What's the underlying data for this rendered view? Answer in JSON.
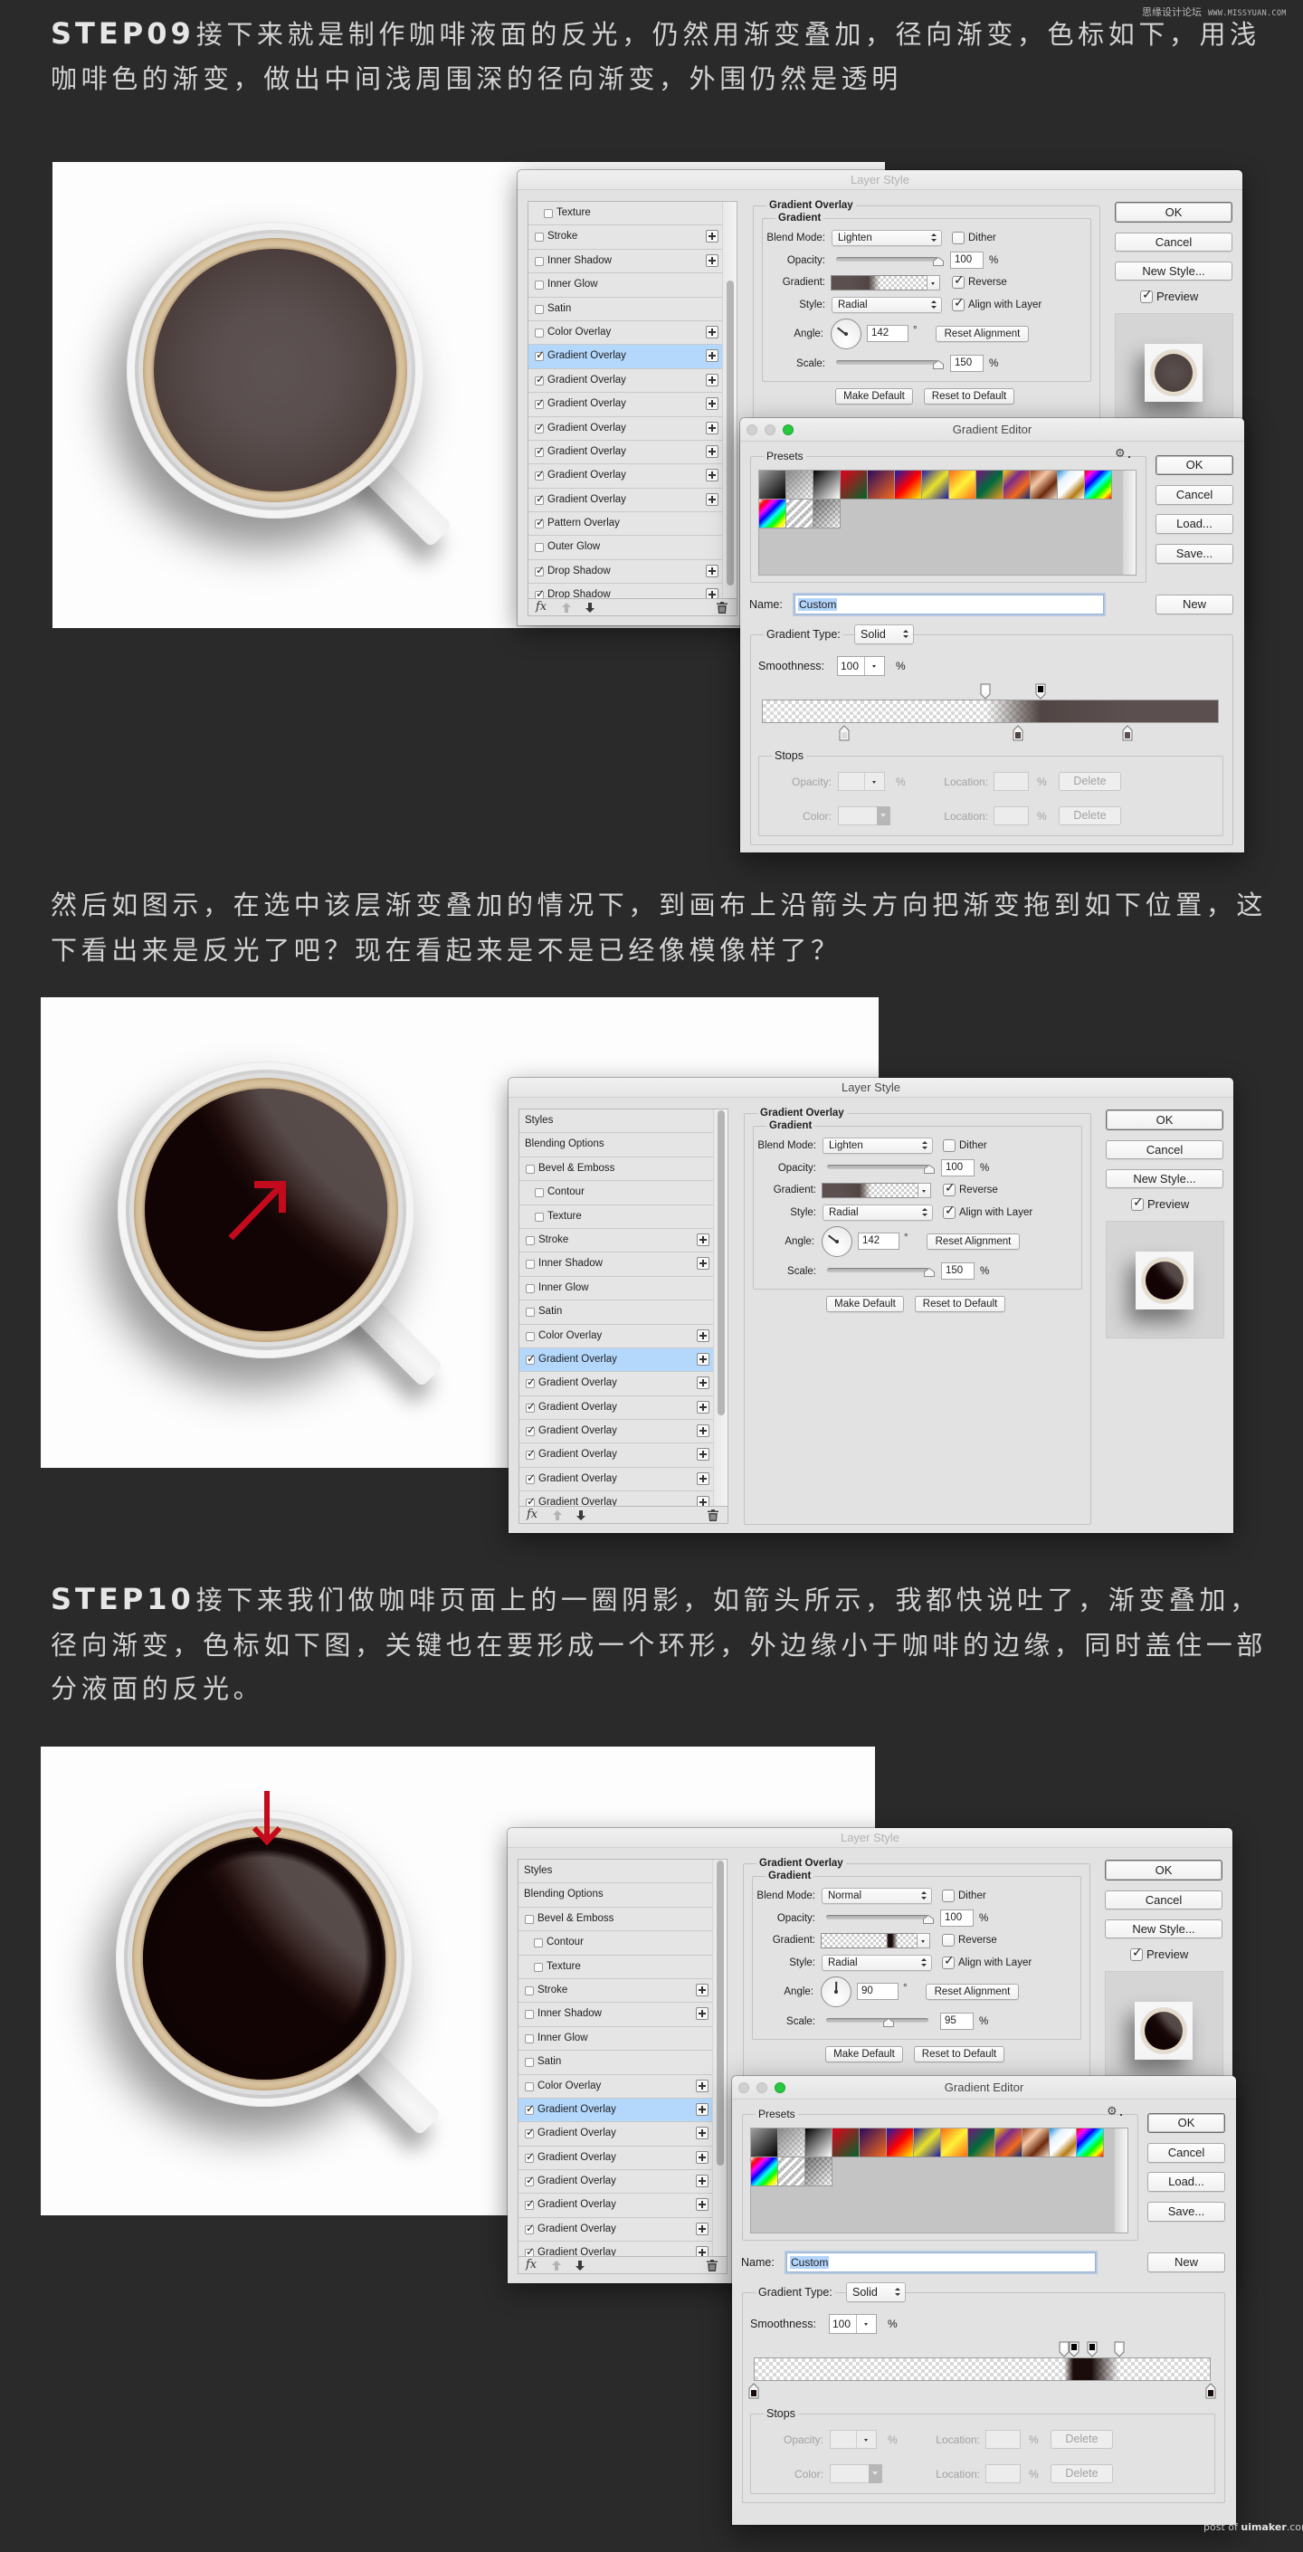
{
  "theme": {
    "page_bg": "#2a2a2a",
    "text": "#d3d3d3",
    "arrow": "#c30b1d",
    "canvas_bg": "#fdfdfd",
    "list_selection": "#b4d8fc",
    "window_zoom_button": "#28c840"
  },
  "watermark_top": {
    "site_name": "思缘设计论坛",
    "site_url": "WWW.MISSYUAN.COM"
  },
  "watermark_bottom": {
    "prefix": "post of ",
    "brand": "uimaker",
    "suffix": ".com"
  },
  "step09": {
    "label": "STEP09",
    "lines": [
      "接下来就是制作咖啡液面的反光，仍然用渐变叠加，径向渐变，色标如下，用浅",
      "咖啡色的渐变，做出中间浅周围深的径向渐变，外围仍然是透明"
    ]
  },
  "note": {
    "lines": [
      "然后如图示，在选中该层渐变叠加的情况下，到画布上沿箭头方向把渐变拖到如下位置，这",
      "下看出来是反光了吧？现在看起来是不是已经像模像样了？"
    ]
  },
  "step10": {
    "label": "STEP10",
    "lines": [
      "接下来我们做咖啡页面上的一圈阴影，如箭头所示，我都快说吐了，渐变叠加，",
      "径向渐变，色标如下图，关键也在要形成一个环形，外边缘小于咖啡的边缘，同时盖住一部",
      "分液面的反光。"
    ]
  },
  "canvases": [
    {
      "liquid": {
        "reflection": false,
        "shadow_ring": false
      },
      "arrow": null
    },
    {
      "liquid": {
        "reflection": true,
        "shadow_ring": false
      },
      "arrow": "up-right"
    },
    {
      "liquid": {
        "reflection": true,
        "shadow_ring": true
      },
      "arrow": "down"
    }
  ],
  "ranges": {
    "opacity": [
      0,
      100
    ],
    "scale": [
      10,
      150
    ]
  },
  "ls_labels": {
    "title": "Layer Style",
    "section_title": "Gradient Overlay",
    "subsection_title": "Gradient",
    "blend_mode": "Blend Mode:",
    "dither": "Dither",
    "opacity": "Opacity:",
    "percent": "%",
    "gradient": "Gradient:",
    "reverse": "Reverse",
    "style": "Style:",
    "align_with_layer": "Align with Layer",
    "angle": "Angle:",
    "degree": "°",
    "reset_alignment": "Reset Alignment",
    "scale": "Scale:",
    "make_default": "Make Default",
    "reset_to_default": "Reset to Default",
    "ok": "OK",
    "cancel": "Cancel",
    "new_style": "New Style...",
    "preview": "Preview",
    "fx": "fx"
  },
  "layer_style_dialogs": [
    {
      "title_active": false,
      "list_scroll": {
        "position": 0.85,
        "visible_fraction": 0.77
      },
      "list_items": [
        {
          "label": "Texture",
          "checkbox": true,
          "indent": true
        },
        {
          "label": "Stroke",
          "checkbox": true,
          "add_button": true
        },
        {
          "label": "Inner Shadow",
          "checkbox": true,
          "add_button": true
        },
        {
          "label": "Inner Glow",
          "checkbox": true
        },
        {
          "label": "Satin",
          "checkbox": true
        },
        {
          "label": "Color Overlay",
          "checkbox": true,
          "add_button": true
        },
        {
          "label": "Gradient Overlay",
          "checkbox": true,
          "checked": true,
          "add_button": true,
          "selected": true
        },
        {
          "label": "Gradient Overlay",
          "checkbox": true,
          "checked": true,
          "add_button": true
        },
        {
          "label": "Gradient Overlay",
          "checkbox": true,
          "checked": true,
          "add_button": true
        },
        {
          "label": "Gradient Overlay",
          "checkbox": true,
          "checked": true,
          "add_button": true
        },
        {
          "label": "Gradient Overlay",
          "checkbox": true,
          "checked": true,
          "add_button": true
        },
        {
          "label": "Gradient Overlay",
          "checkbox": true,
          "checked": true,
          "add_button": true
        },
        {
          "label": "Gradient Overlay",
          "checkbox": true,
          "checked": true,
          "add_button": true
        },
        {
          "label": "Pattern Overlay",
          "checkbox": true,
          "checked": true
        },
        {
          "label": "Outer Glow",
          "checkbox": true
        },
        {
          "label": "Drop Shadow",
          "checkbox": true,
          "checked": true,
          "add_button": true
        },
        {
          "label": "Drop Shadow",
          "checkbox": true,
          "checked": true,
          "add_button": true
        }
      ],
      "blend_mode": "Lighten",
      "dither": false,
      "opacity": 100,
      "gradient": 0,
      "reverse": true,
      "style": "Radial",
      "align_with_layer": true,
      "angle": 142,
      "scale": 150,
      "preview": true,
      "preview_thumb": {
        "reflection": false
      }
    },
    {
      "title_active": true,
      "list_scroll": {
        "position": 0,
        "visible_fraction": 0.77
      },
      "list_items": [
        {
          "label": "Styles"
        },
        {
          "label": "Blending Options"
        },
        {
          "label": "Bevel & Emboss",
          "checkbox": true
        },
        {
          "label": "Contour",
          "checkbox": true,
          "indent": true
        },
        {
          "label": "Texture",
          "checkbox": true,
          "indent": true
        },
        {
          "label": "Stroke",
          "checkbox": true,
          "add_button": true
        },
        {
          "label": "Inner Shadow",
          "checkbox": true,
          "add_button": true
        },
        {
          "label": "Inner Glow",
          "checkbox": true
        },
        {
          "label": "Satin",
          "checkbox": true
        },
        {
          "label": "Color Overlay",
          "checkbox": true,
          "add_button": true
        },
        {
          "label": "Gradient Overlay",
          "checkbox": true,
          "checked": true,
          "add_button": true,
          "selected": true
        },
        {
          "label": "Gradient Overlay",
          "checkbox": true,
          "checked": true,
          "add_button": true
        },
        {
          "label": "Gradient Overlay",
          "checkbox": true,
          "checked": true,
          "add_button": true
        },
        {
          "label": "Gradient Overlay",
          "checkbox": true,
          "checked": true,
          "add_button": true
        },
        {
          "label": "Gradient Overlay",
          "checkbox": true,
          "checked": true,
          "add_button": true
        },
        {
          "label": "Gradient Overlay",
          "checkbox": true,
          "checked": true,
          "add_button": true
        },
        {
          "label": "Gradient Overlay",
          "checkbox": true,
          "checked": true,
          "add_button": true
        }
      ],
      "blend_mode": "Lighten",
      "dither": false,
      "opacity": 100,
      "gradient": 0,
      "reverse": true,
      "style": "Radial",
      "align_with_layer": true,
      "angle": 142,
      "scale": 150,
      "preview": true,
      "preview_thumb": {
        "reflection": true
      }
    },
    {
      "title_active": false,
      "list_scroll": {
        "position": 0,
        "visible_fraction": 0.77
      },
      "list_items": [
        {
          "label": "Styles"
        },
        {
          "label": "Blending Options"
        },
        {
          "label": "Bevel & Emboss",
          "checkbox": true
        },
        {
          "label": "Contour",
          "checkbox": true,
          "indent": true
        },
        {
          "label": "Texture",
          "checkbox": true,
          "indent": true
        },
        {
          "label": "Stroke",
          "checkbox": true,
          "add_button": true
        },
        {
          "label": "Inner Shadow",
          "checkbox": true,
          "add_button": true
        },
        {
          "label": "Inner Glow",
          "checkbox": true
        },
        {
          "label": "Satin",
          "checkbox": true
        },
        {
          "label": "Color Overlay",
          "checkbox": true,
          "add_button": true
        },
        {
          "label": "Gradient Overlay",
          "checkbox": true,
          "checked": true,
          "add_button": true,
          "selected": true
        },
        {
          "label": "Gradient Overlay",
          "checkbox": true,
          "checked": true,
          "add_button": true
        },
        {
          "label": "Gradient Overlay",
          "checkbox": true,
          "checked": true,
          "add_button": true
        },
        {
          "label": "Gradient Overlay",
          "checkbox": true,
          "checked": true,
          "add_button": true
        },
        {
          "label": "Gradient Overlay",
          "checkbox": true,
          "checked": true,
          "add_button": true
        },
        {
          "label": "Gradient Overlay",
          "checkbox": true,
          "checked": true,
          "add_button": true
        },
        {
          "label": "Gradient Overlay",
          "checkbox": true,
          "checked": true,
          "add_button": true
        }
      ],
      "blend_mode": "Normal",
      "dither": false,
      "opacity": 100,
      "gradient": 1,
      "reverse": false,
      "style": "Radial",
      "align_with_layer": true,
      "angle": 90,
      "scale": 95,
      "preview": true,
      "preview_thumb": {
        "reflection": true
      }
    }
  ],
  "ge_labels": {
    "title": "Gradient Editor",
    "presets": "Presets",
    "ok": "OK",
    "cancel": "Cancel",
    "load": "Load...",
    "save": "Save...",
    "name": "Name:",
    "new": "New",
    "gradient_type": "Gradient Type:",
    "smoothness": "Smoothness:",
    "percent": "%",
    "stops": "Stops",
    "opacity": "Opacity:",
    "color": "Color:",
    "location": "Location:",
    "delete": "Delete"
  },
  "gradient_editors": [
    {
      "name_value": "Custom",
      "gradient_type": "Solid",
      "smoothness": "100",
      "gradient": 0
    },
    {
      "name_value": "Custom",
      "gradient_type": "Solid",
      "smoothness": "100",
      "gradient": 1
    }
  ],
  "gradients": [
    {
      "opacity_stops": [
        {
          "location": 49,
          "opacity": 0
        },
        {
          "location": 61,
          "opacity": 100
        }
      ],
      "color_stops": [
        {
          "location": 18,
          "color": "#dedad8"
        },
        {
          "location": 56,
          "color": "#4e4341"
        },
        {
          "location": 80,
          "color": "#5b504f"
        }
      ]
    },
    {
      "opacity_stops": [
        {
          "location": 68,
          "opacity": 0
        },
        {
          "location": 70,
          "opacity": 100
        },
        {
          "location": 74,
          "opacity": 100
        },
        {
          "location": 80,
          "opacity": 0
        }
      ],
      "color_stops": [
        {
          "location": 0,
          "color": "#1a0c0a"
        },
        {
          "location": 100,
          "color": "#1a0c0a"
        }
      ]
    }
  ],
  "presets": [
    {
      "colors": [
        "#a0a0a0",
        "#000000"
      ]
    },
    {
      "colors": [
        "#888888",
        "#88888800"
      ],
      "checker": true
    },
    {
      "colors": [
        "#000000",
        "#ffffff"
      ]
    },
    {
      "colors": [
        "#e3001b",
        "#00652b"
      ]
    },
    {
      "colors": [
        "#2b0a5e",
        "#f26a1b"
      ]
    },
    {
      "colors": [
        "#1d1ba8",
        "#ff0000",
        "#fff200"
      ]
    },
    {
      "colors": [
        "#1d1ba8",
        "#e8e22a",
        "#1d1ba8"
      ]
    },
    {
      "colors": [
        "#ff6a13",
        "#fff23a",
        "#ff6a13"
      ]
    },
    {
      "colors": [
        "#7b0f7e",
        "#006b3c",
        "#f7941d"
      ]
    },
    {
      "colors": [
        "#ffd100",
        "#7d2b8b",
        "#f26a1b",
        "#0a2a7a"
      ]
    },
    {
      "colors": [
        "#973d12",
        "#f4c7a6",
        "#6b2a0c",
        "#f6dccb"
      ]
    },
    {
      "colors": [
        "#1f8fde",
        "#e6f2fb",
        "#ffffff",
        "#b37a12",
        "#ffffff"
      ]
    },
    {
      "colors": [
        "#ff0000",
        "#ff00ff",
        "#0000ff",
        "#00ffff",
        "#00ff00",
        "#ffff00",
        "#ff0000"
      ]
    },
    {
      "colors": [
        "#ff000000",
        "#ff0000",
        "#ff00ff",
        "#0000ff",
        "#00ffff",
        "#00ff00",
        "#ffff00",
        "#ff000000"
      ],
      "checker": true
    },
    {
      "colors": [
        "#ffffff",
        "#ffffff00"
      ],
      "checker": true,
      "stripes": true
    },
    {
      "colors": [
        "#00000088",
        "#00000000"
      ],
      "checker": true
    }
  ]
}
